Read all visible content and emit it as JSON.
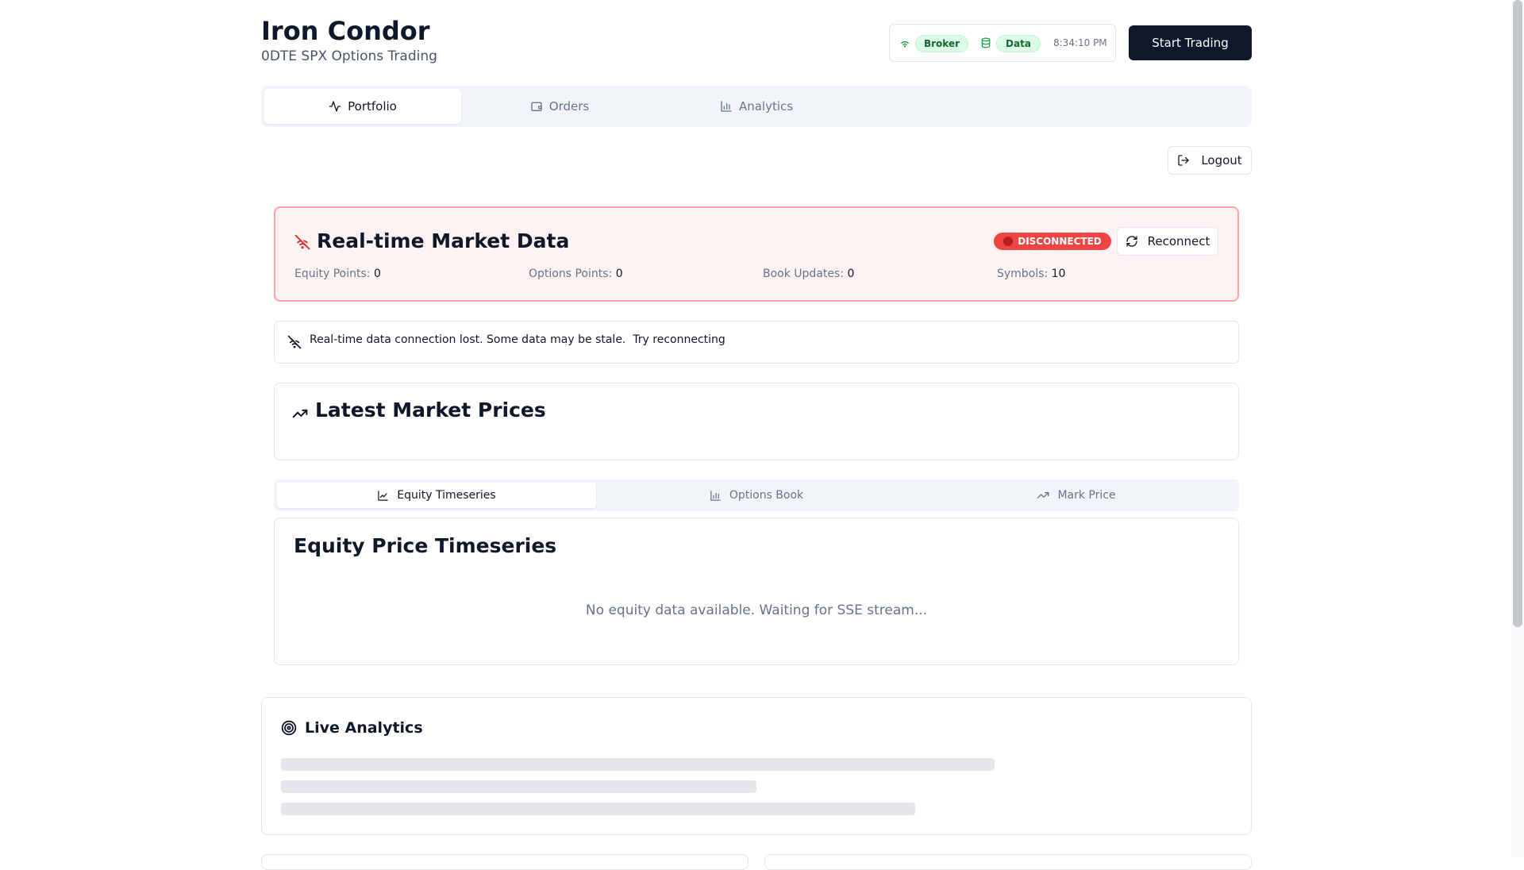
{
  "header": {
    "title": "Iron Condor",
    "subtitle": "0DTE SPX Options Trading",
    "status": {
      "broker_label": "Broker",
      "data_label": "Data",
      "time": "8:34:10 PM"
    },
    "start_button": "Start Trading"
  },
  "tabs": [
    {
      "label": "Portfolio",
      "icon": "activity-icon",
      "active": true
    },
    {
      "label": "Orders",
      "icon": "wallet-icon",
      "active": false
    },
    {
      "label": "Analytics",
      "icon": "bar-chart-icon",
      "active": false
    }
  ],
  "logout_label": "Logout",
  "market_data": {
    "title": "Real-time Market Data",
    "status_badge": "DISCONNECTED",
    "reconnect_label": "Reconnect",
    "stats": [
      {
        "label": "Equity Points:",
        "value": "0"
      },
      {
        "label": "Options Points:",
        "value": "0"
      },
      {
        "label": "Book Updates:",
        "value": "0"
      },
      {
        "label": "Symbols:",
        "value": "10"
      }
    ]
  },
  "alert": {
    "message": "Real-time data connection lost. Some data may be stale.",
    "link": "Try reconnecting"
  },
  "latest_prices": {
    "title": "Latest Market Prices"
  },
  "subtabs": [
    {
      "label": "Equity Timeseries",
      "icon": "line-chart-icon",
      "active": true
    },
    {
      "label": "Options Book",
      "icon": "bar-chart-icon",
      "active": false
    },
    {
      "label": "Mark Price",
      "icon": "trending-up-icon",
      "active": false
    }
  ],
  "equity": {
    "title": "Equity Price Timeseries",
    "empty_message": "No equity data available. Waiting for SSE stream..."
  },
  "analytics": {
    "title": "Live Analytics"
  },
  "colors": {
    "primary": "#0f172a",
    "danger": "#ef4444",
    "danger_bg": "#fef2f2",
    "success_bg": "#dcfce7",
    "success_text": "#166534"
  }
}
